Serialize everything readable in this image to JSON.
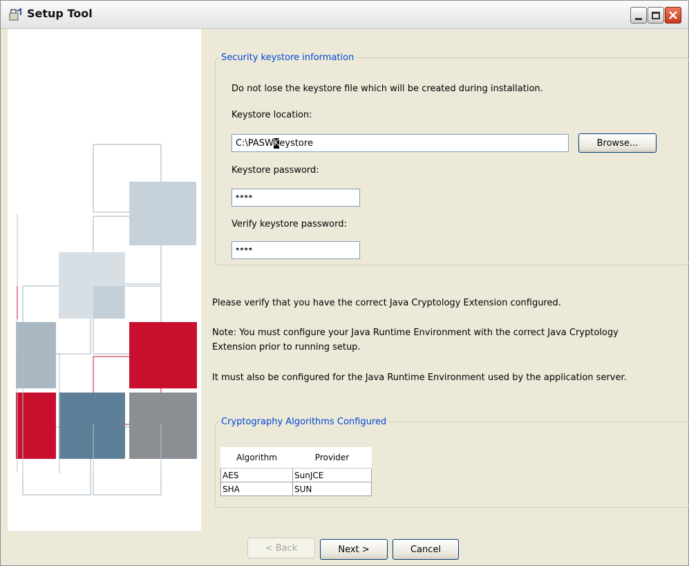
{
  "window": {
    "title": "Setup Tool"
  },
  "keystore_group": {
    "legend": "Security keystore information",
    "warning": "Do not lose the keystore file which will be created during installation.",
    "location_label": "Keystore location:",
    "location_before_caret": "C:\\PASW",
    "location_caret_char": "K",
    "location_after_caret": "eystore",
    "browse_label": "Browse...",
    "password_label": "Keystore password:",
    "password_value": "****",
    "verify_label": "Verify keystore password:",
    "verify_value": "****"
  },
  "info": {
    "line1": "Please verify that you have the correct Java Cryptology Extension configured.",
    "note_line1": "Note:  You must configure your Java Runtime Environment with the correct Java Cryptology",
    "note_line2": "Extension prior to running setup.",
    "line3": "It must also be configured for the Java Runtime Environment used by the application server."
  },
  "crypto_group": {
    "legend": "Cryptography Algorithms Configured",
    "columns": [
      "Algorithm",
      "Provider"
    ],
    "rows": [
      {
        "algorithm": "AES",
        "provider": "SunJCE"
      },
      {
        "algorithm": "SHA",
        "provider": "SUN"
      }
    ]
  },
  "buttons": {
    "back": "< Back",
    "next": "Next >",
    "cancel": "Cancel"
  },
  "colors": {
    "legend_blue": "#0046d5",
    "accent_red": "#c8102e",
    "slate_blue": "#5e7f98",
    "gray": "#8a8f94",
    "light_blue_gray": "#b9c6d1"
  }
}
